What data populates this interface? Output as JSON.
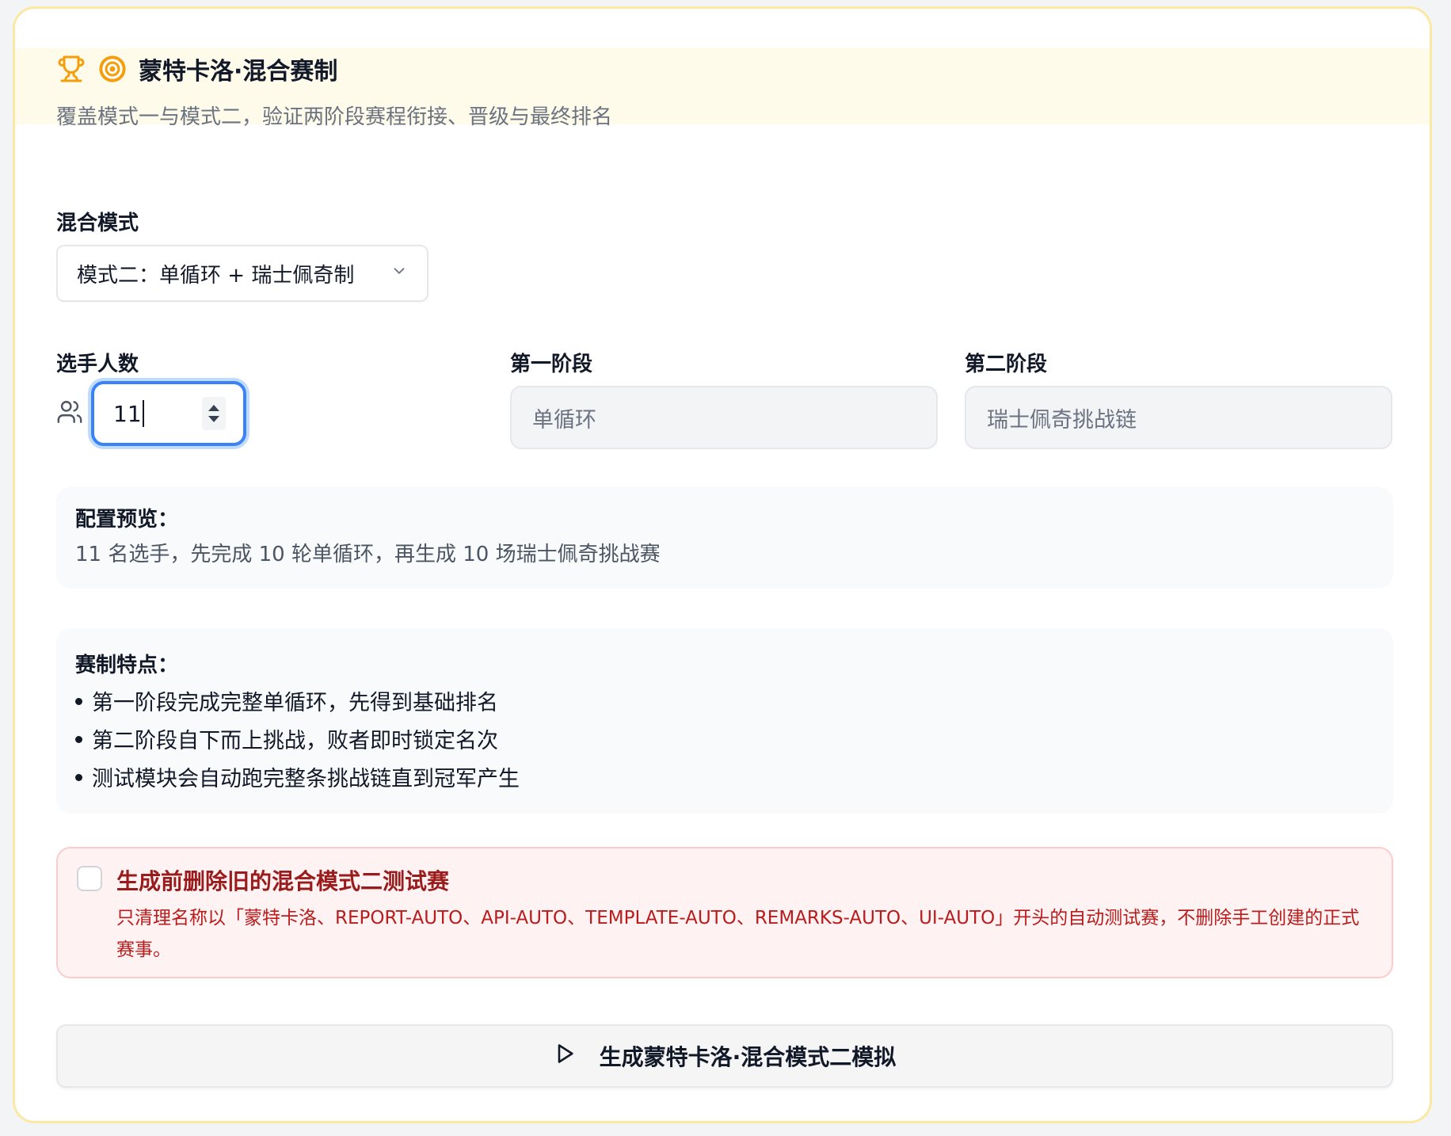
{
  "header": {
    "title": "蒙特卡洛·混合赛制",
    "subtitle": "覆盖模式一与模式二，验证两阶段赛程衔接、晋级与最终排名",
    "icons": [
      "trophy-icon",
      "target-icon"
    ],
    "accent_color": "#f59e0b"
  },
  "mode": {
    "label": "混合模式",
    "selected": "模式二：单循环 + 瑞士佩奇制"
  },
  "players": {
    "label": "选手人数",
    "value": "11"
  },
  "stage1": {
    "label": "第一阶段",
    "value": "单循环"
  },
  "stage2": {
    "label": "第二阶段",
    "value": "瑞士佩奇挑战链"
  },
  "preview": {
    "title": "配置预览：",
    "text": "11 名选手，先完成 10 轮单循环，再生成 10 场瑞士佩奇挑战赛"
  },
  "features": {
    "title": "赛制特点：",
    "items": [
      "第一阶段完成完整单循环，先得到基础排名",
      "第二阶段自下而上挑战，败者即时锁定名次",
      "测试模块会自动跑完整条挑战链直到冠军产生"
    ]
  },
  "cleanup": {
    "checked": false,
    "title": "生成前删除旧的混合模式二测试赛",
    "text": "只清理名称以「蒙特卡洛、REPORT-AUTO、API-AUTO、TEMPLATE-AUTO、REMARKS-AUTO、UI-AUTO」开头的自动测试赛，不删除手工创建的正式赛事。"
  },
  "action": {
    "label": "生成蒙特卡洛·混合模式二模拟"
  }
}
